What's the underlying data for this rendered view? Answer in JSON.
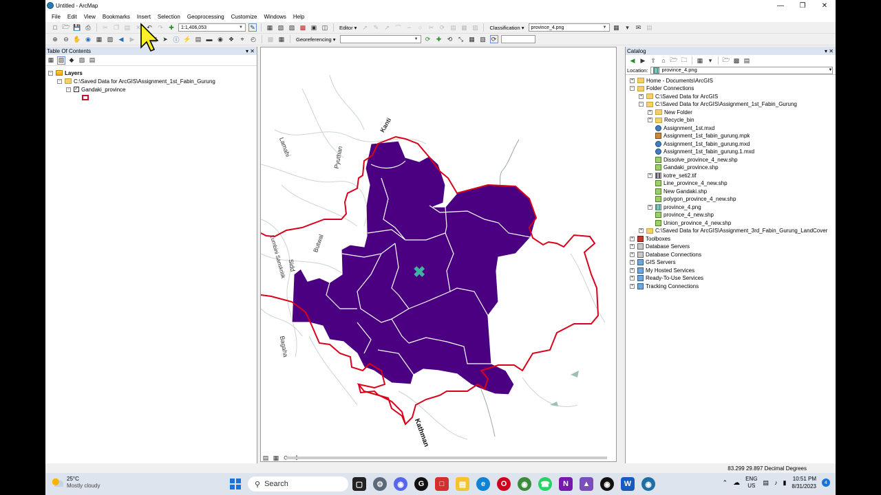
{
  "window": {
    "title": "Untitled - ArcMap"
  },
  "menu": [
    "File",
    "Edit",
    "View",
    "Bookmarks",
    "Insert",
    "Selection",
    "Geoprocessing",
    "Customize",
    "Windows",
    "Help"
  ],
  "toolbar": {
    "scale": "1:1,406,053",
    "editor_label": "Editor",
    "classification_label": "Classification",
    "classification_layer": "province_4.png",
    "georeferencing_label": "Georeferencing"
  },
  "toc": {
    "title": "Table Of Contents",
    "layers_label": "Layers",
    "data_source": "C:\\Saved Data for ArcGIS\\Assignment_1st_Fabin_Gurung",
    "layer_name": "Gandaki_province",
    "layer_checked": true,
    "symbol_color": "#c8102e"
  },
  "map": {
    "fill_color": "#4b0082",
    "outline_color": "#d9001b",
    "labels": [
      "Kanti",
      "Pyuthan",
      "Lamahi",
      "Butwal",
      "Lumbini Sanskritik",
      "Sidd",
      "Bagaha",
      "Kathman"
    ]
  },
  "catalog": {
    "title": "Catalog",
    "location_label": "Location:",
    "location_value": "province_4.png",
    "tree": [
      {
        "label": "Home - Documents\\ArcGIS",
        "icon": "folder",
        "depth": 0,
        "exp": "+"
      },
      {
        "label": "Folder Connections",
        "icon": "folder",
        "depth": 0,
        "exp": "-"
      },
      {
        "label": "C:\\Saved Data for ArcGIS",
        "icon": "folder",
        "depth": 1,
        "exp": "+"
      },
      {
        "label": "C:\\Saved Data for ArcGIS\\Assignment_1st_Fabin_Gurung",
        "icon": "folder",
        "depth": 1,
        "exp": "-"
      },
      {
        "label": "New Folder",
        "icon": "folder",
        "depth": 2,
        "exp": "+"
      },
      {
        "label": "Recycle_bin",
        "icon": "folder",
        "depth": 2,
        "exp": "+"
      },
      {
        "label": "Assignment_1st.mxd",
        "icon": "mxd",
        "depth": 2,
        "exp": ""
      },
      {
        "label": "Assignment_1st_fabin_gurung.mpk",
        "icon": "mpk",
        "depth": 2,
        "exp": ""
      },
      {
        "label": "Assignment_1st_fabin_gurung.mxd",
        "icon": "mxd",
        "depth": 2,
        "exp": ""
      },
      {
        "label": "Assignment_1st_fabin_gurung.1.mxd",
        "icon": "mxd",
        "depth": 2,
        "exp": ""
      },
      {
        "label": "Dissolve_province_4_new.shp",
        "icon": "shp",
        "depth": 2,
        "exp": ""
      },
      {
        "label": "Gandaki_province.shp",
        "icon": "shp",
        "depth": 2,
        "exp": ""
      },
      {
        "label": "kotre_seti2.tif",
        "icon": "tif",
        "depth": 2,
        "exp": "+"
      },
      {
        "label": "Line_province_4_new.shp",
        "icon": "shp",
        "depth": 2,
        "exp": ""
      },
      {
        "label": "New Gandaki.shp",
        "icon": "shp",
        "depth": 2,
        "exp": ""
      },
      {
        "label": "polygon_province_4_new.shp",
        "icon": "shp",
        "depth": 2,
        "exp": ""
      },
      {
        "label": "province_4.png",
        "icon": "png",
        "depth": 2,
        "exp": "+"
      },
      {
        "label": "province_4_new.shp",
        "icon": "shp",
        "depth": 2,
        "exp": ""
      },
      {
        "label": "Union_province_4_new.shp",
        "icon": "shp",
        "depth": 2,
        "exp": ""
      },
      {
        "label": "C:\\Saved Data for ArcGIS\\Assignment_3rd_Fabin_Gurung_LandCover",
        "icon": "folder",
        "depth": 1,
        "exp": "+"
      },
      {
        "label": "Toolboxes",
        "icon": "tool",
        "depth": 0,
        "exp": "+"
      },
      {
        "label": "Database Servers",
        "icon": "db",
        "depth": 0,
        "exp": "+"
      },
      {
        "label": "Database Connections",
        "icon": "db",
        "depth": 0,
        "exp": "+"
      },
      {
        "label": "GIS Servers",
        "icon": "srv",
        "depth": 0,
        "exp": "+"
      },
      {
        "label": "My Hosted Services",
        "icon": "srv",
        "depth": 0,
        "exp": "+"
      },
      {
        "label": "Ready-To-Use Services",
        "icon": "srv",
        "depth": 0,
        "exp": "+"
      },
      {
        "label": "Tracking Connections",
        "icon": "srv",
        "depth": 0,
        "exp": "+"
      }
    ]
  },
  "status": {
    "coordinates": "83.299  29.897 Decimal Degrees"
  },
  "taskbar": {
    "temperature": "25°C",
    "weather": "Mostly cloudy",
    "search": "Search",
    "lang1": "ENG",
    "lang2": "US",
    "time": "10:51 PM",
    "date": "8/31/2023",
    "notifications": "4"
  }
}
